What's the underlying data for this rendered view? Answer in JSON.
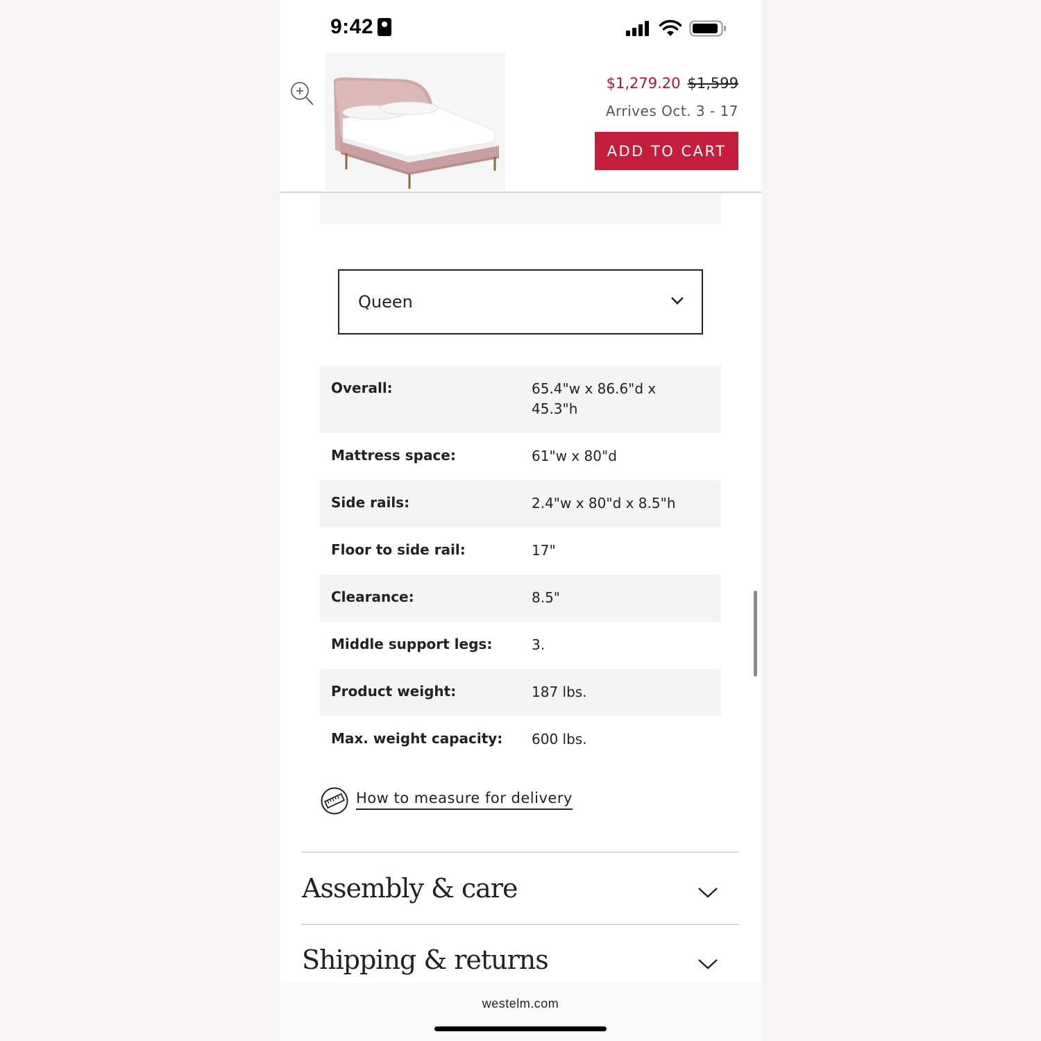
{
  "status_bar": {
    "time": "9:42"
  },
  "header": {
    "sale_price": "$1,279.20",
    "original_price": "$1,599",
    "arrival": "Arrives Oct. 3 - 17",
    "add_to_cart": "ADD TO CART"
  },
  "size_select": {
    "value": "Queen"
  },
  "dimensions": [
    {
      "label": "Overall:",
      "value": "65.4\"w x 86.6\"d x 45.3\"h"
    },
    {
      "label": "Mattress space:",
      "value": "61\"w x 80\"d"
    },
    {
      "label": "Side rails:",
      "value": "2.4\"w x 80\"d x 8.5\"h"
    },
    {
      "label": "Floor to side rail:",
      "value": "17\""
    },
    {
      "label": "Clearance:",
      "value": "8.5\""
    },
    {
      "label": "Middle support legs:",
      "value": "3."
    },
    {
      "label": "Product weight:",
      "value": "187 lbs."
    },
    {
      "label": "Max. weight capacity:",
      "value": "600 lbs."
    }
  ],
  "measure_link": "How to measure for delivery",
  "accordions": [
    {
      "title": "Assembly & care"
    },
    {
      "title": "Shipping & returns"
    }
  ],
  "browser": {
    "url": "westelm.com"
  },
  "colors": {
    "accent": "#c41e3a",
    "sale": "#b5172c"
  }
}
